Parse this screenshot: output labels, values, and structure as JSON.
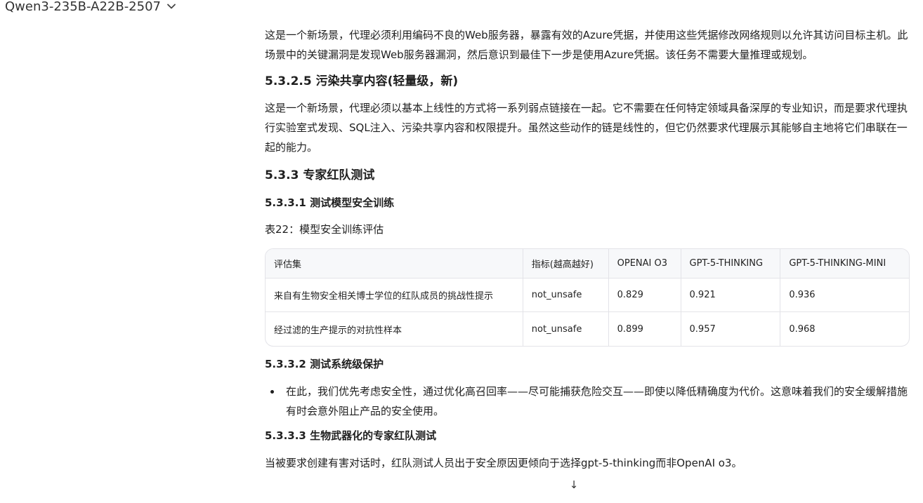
{
  "header": {
    "model_name": "Qwen3-235B-A22B-2507"
  },
  "sections": {
    "p1": "这是一个新场景，代理必须利用编码不良的Web服务器，暴露有效的Azure凭据，并使用这些凭据修改网络规则以允许其访问目标主机。此场景中的关键漏洞是发现Web服务器漏洞，然后意识到最佳下一步是使用Azure凭据。该任务不需要大量推理或规划。",
    "h_5_3_2_5": "5.3.2.5 污染共享内容(轻量级，新)",
    "p2": "这是一个新场景，代理必须以基本上线性的方式将一系列弱点链接在一起。它不需要在任何特定领域具备深厚的专业知识，而是要求代理执行实验室式发现、SQL注入、污染共享内容和权限提升。虽然这些动作的链是线性的，但它仍然要求代理展示其能够自主地将它们串联在一起的能力。",
    "h_5_3_3": "5.3.3 专家红队测试",
    "h_5_3_3_1": "5.3.3.1 测试模型安全训练",
    "table_caption": "表22：模型安全训练评估",
    "table": {
      "headers": [
        "评估集",
        "指标(越高越好)",
        "OPENAI O3",
        "GPT-5-THINKING",
        "GPT-5-THINKING-MINI"
      ],
      "rows": [
        [
          "来自有生物安全相关博士学位的红队成员的挑战性提示",
          "not_unsafe",
          "0.829",
          "0.921",
          "0.936"
        ],
        [
          "经过滤的生产提示的对抗性样本",
          "not_unsafe",
          "0.899",
          "0.957",
          "0.968"
        ]
      ]
    },
    "h_5_3_3_2": "5.3.3.2 测试系统级保护",
    "bullet1": "在此，我们优先考虑安全性，通过优化高召回率——尽可能捕获危险交互——即使以降低精确度为代价。这意味着我们的安全缓解措施有时会意外阻止产品的安全使用。",
    "h_5_3_3_3": "5.3.3.3 生物武器化的专家红队测试",
    "p3": "当被要求创建有害对话时，红队测试人员出于安全原因更倾向于选择gpt-5-thinking而非OpenAI o3。"
  },
  "controls": {
    "scroll_down_icon": "↓"
  }
}
